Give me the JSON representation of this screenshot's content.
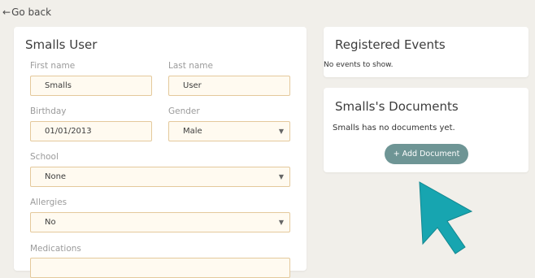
{
  "nav": {
    "back_label": "Go back"
  },
  "profile": {
    "title": "Smalls User",
    "first_name": {
      "label": "First name",
      "value": "Smalls"
    },
    "last_name": {
      "label": "Last name",
      "value": "User"
    },
    "birthday": {
      "label": "Birthday",
      "value": "01/01/2013"
    },
    "gender": {
      "label": "Gender",
      "value": "Male"
    },
    "school": {
      "label": "School",
      "value": "None"
    },
    "allergies": {
      "label": "Allergies",
      "value": "No"
    },
    "medications": {
      "label": "Medications"
    }
  },
  "events": {
    "title": "Registered Events",
    "empty_text": "No events to show."
  },
  "documents": {
    "title": "Smalls's Documents",
    "empty_text": "Smalls has no documents yet.",
    "add_button_label": "+ Add Document"
  },
  "colors": {
    "background": "#f1efea",
    "field_fill": "#fffaf0",
    "field_border": "#e4c99c",
    "button": "#6e9595",
    "pointer": "#17a5b0"
  },
  "icons": {
    "back": "arrow-left-icon",
    "select": "caret-down-icon",
    "pointer": "mouse-pointer-icon"
  }
}
